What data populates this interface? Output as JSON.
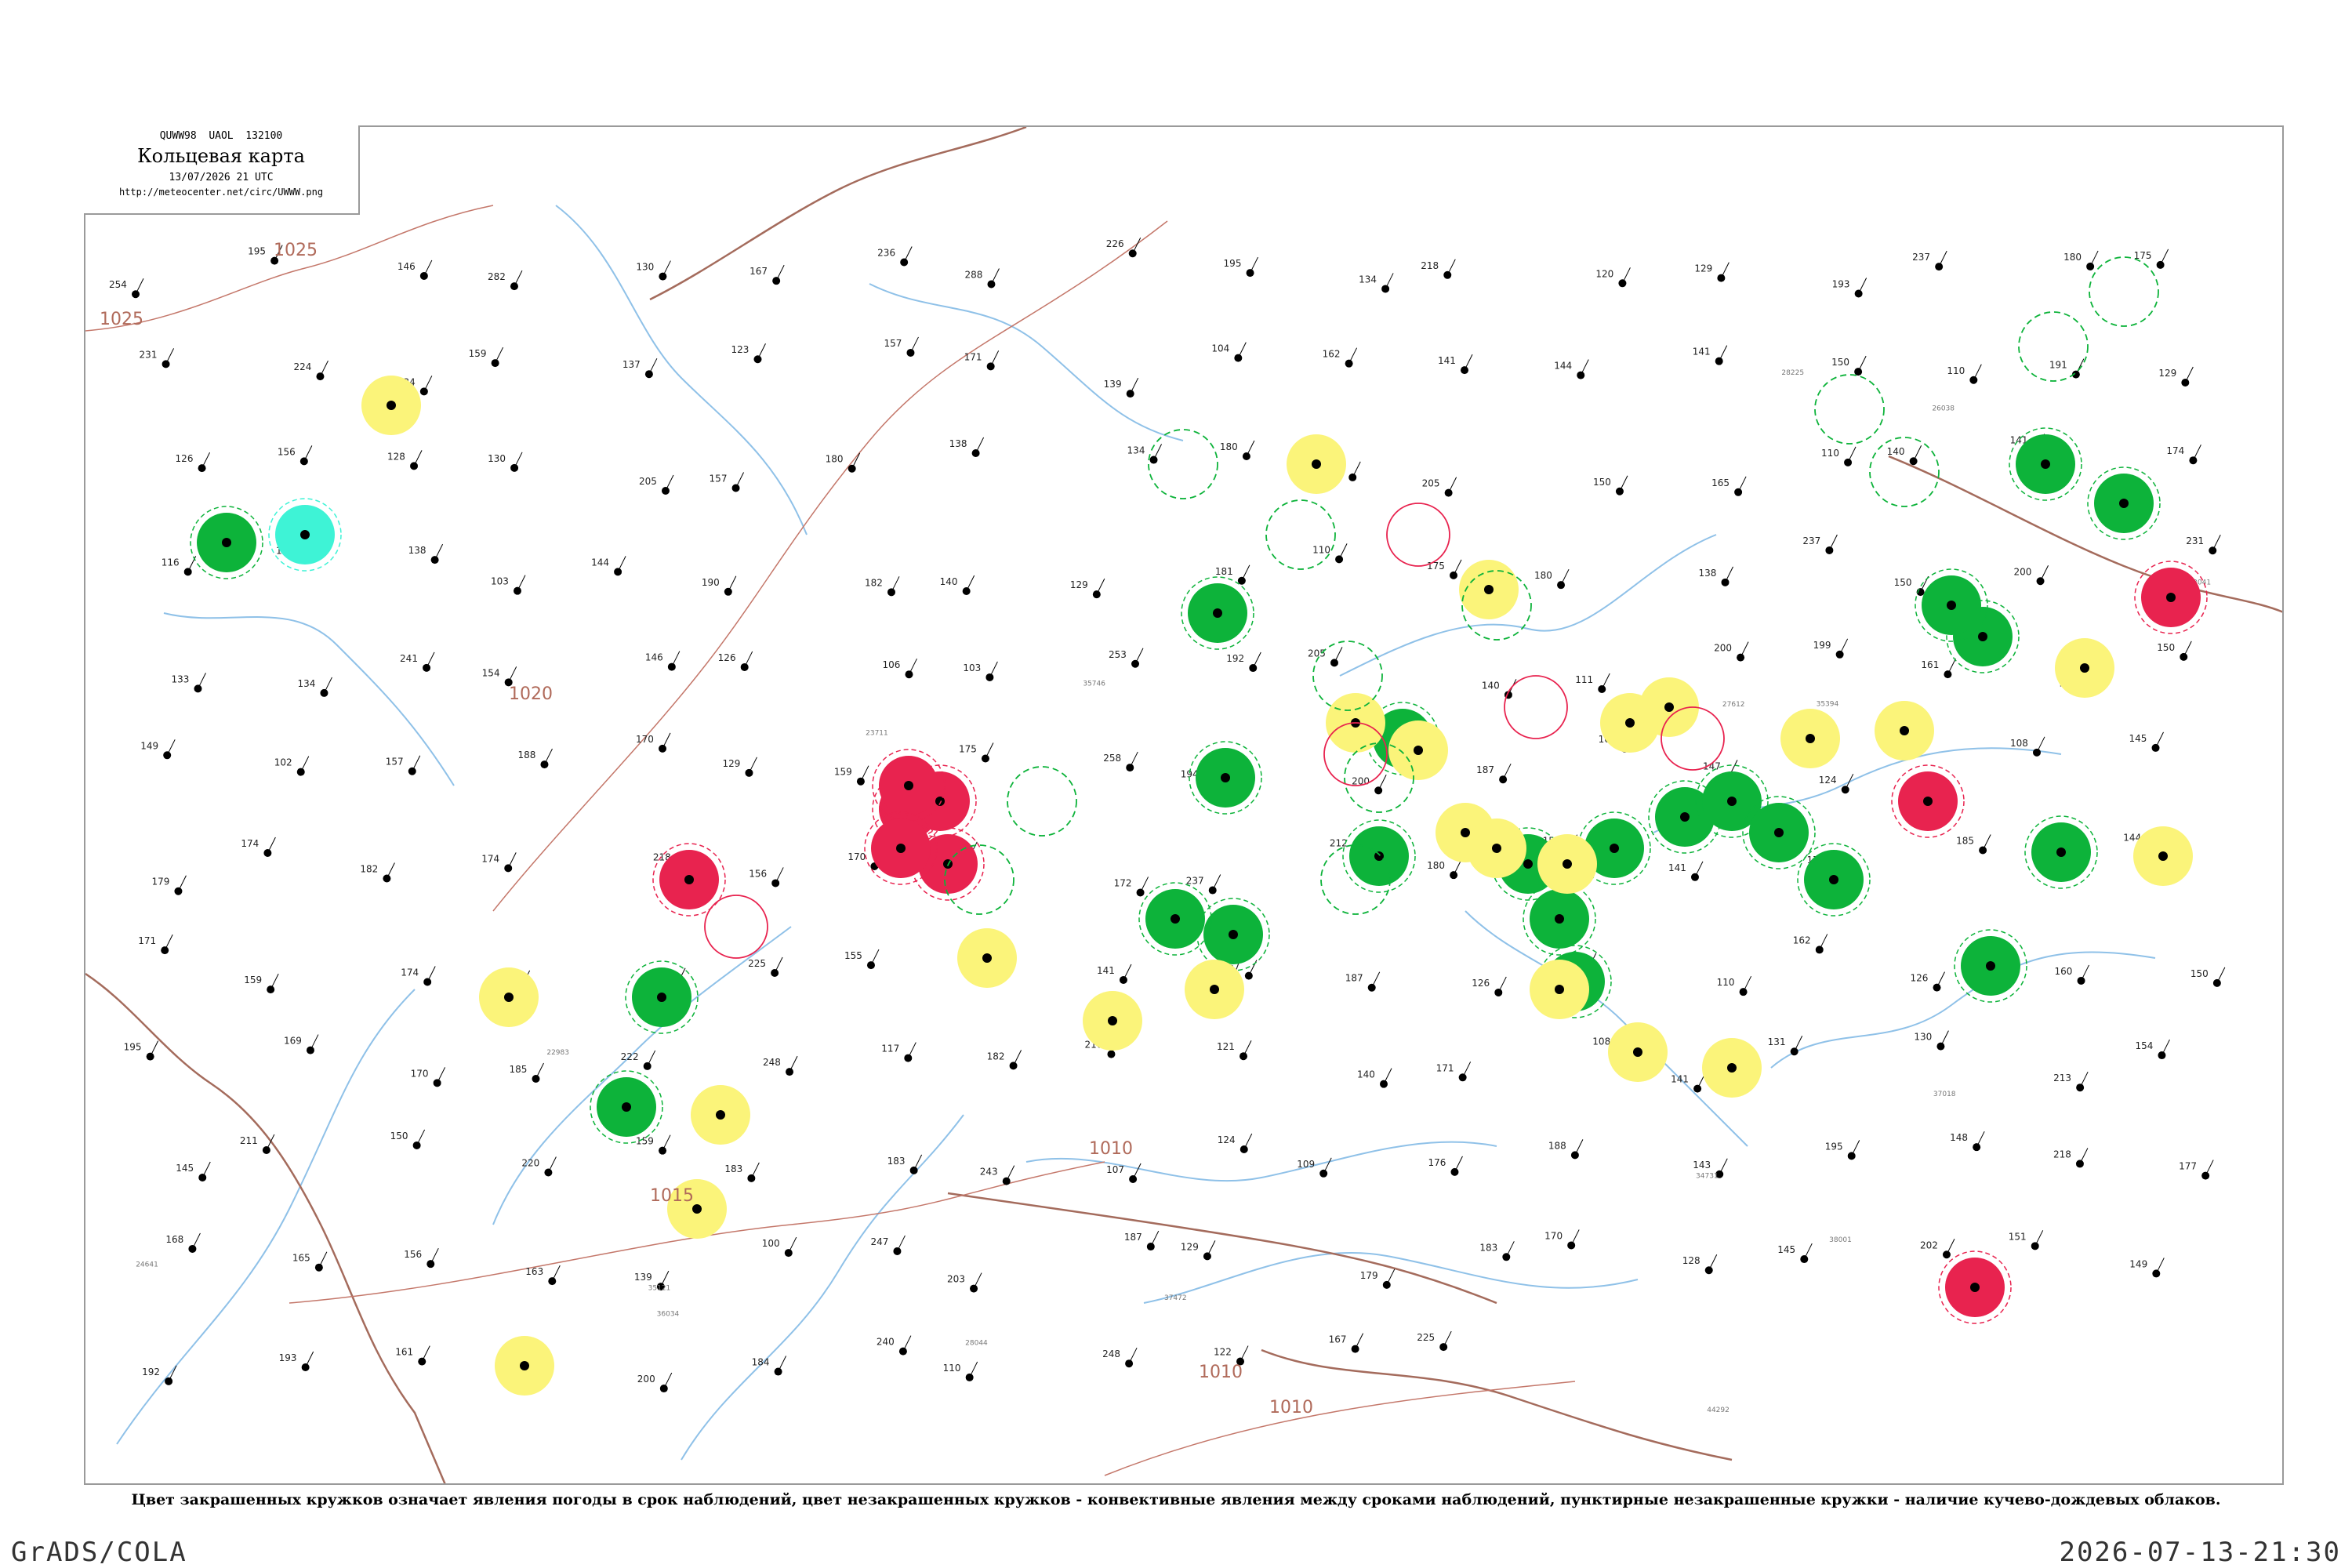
{
  "header": {
    "code_line": "QUWW98  UAOL  132100",
    "title": "Кольцевая карта",
    "date": "13/07/2026 21 UTC",
    "url": "http://meteocenter.net/circ/UWWW.png"
  },
  "caption": "Цвет закрашенных кружков означает явления погоды в срок наблюдений, цвет незакрашенных кружков - конвективные явления между сроками наблюдений, пунктирные незакрашенные кружки - наличие кучево-дождевых облаков.",
  "footer": {
    "left": "GrADS/COLA",
    "right": "2026-07-13-21:30"
  },
  "colors": {
    "green": "#0db33a",
    "red": "#e8234f",
    "yellow": "#fbf47a",
    "cyan": "#3ef3d6",
    "river": "#8fc1e8",
    "border": "#a46b5c",
    "isobar": "#c4776a"
  },
  "isobar_labels": [
    "1025",
    "1025",
    "1020",
    "1015",
    "1010",
    "1010",
    "1010"
  ],
  "observation_labels": [
    "254",
    "195",
    "146",
    "282",
    "130",
    "167",
    "236",
    "288",
    "226",
    "195",
    "134",
    "218",
    "120",
    "129",
    "193",
    "237",
    "180",
    "175",
    "231",
    "224",
    "234",
    "159",
    "137",
    "123",
    "157",
    "171",
    "139",
    "104",
    "162",
    "141",
    "144",
    "141",
    "150",
    "110",
    "191",
    "129",
    "126",
    "156",
    "128",
    "130",
    "205",
    "157",
    "180",
    "138",
    "134",
    "180",
    "160",
    "205",
    "150",
    "165",
    "110",
    "140",
    "141",
    "174",
    "116",
    "160",
    "138",
    "103",
    "144",
    "190",
    "182",
    "140",
    "129",
    "181",
    "110",
    "175",
    "180",
    "138",
    "237",
    "150",
    "200",
    "231",
    "133",
    "134",
    "241",
    "154",
    "146",
    "126",
    "106",
    "103",
    "253",
    "192",
    "205",
    "140",
    "111",
    "200",
    "199",
    "161",
    "135",
    "150",
    "149",
    "102",
    "157",
    "188",
    "170",
    "129",
    "159",
    "175",
    "258",
    "194",
    "200",
    "187",
    "167",
    "147",
    "124",
    "130",
    "108",
    "145",
    "179",
    "174",
    "182",
    "174",
    "218",
    "156",
    "170",
    "211",
    "172",
    "237",
    "212",
    "180",
    "151",
    "141",
    "179",
    "185",
    "178",
    "144",
    "171",
    "159",
    "174",
    "173",
    "166",
    "225",
    "155",
    "135",
    "141",
    "157",
    "187",
    "126",
    "210",
    "110",
    "162",
    "126",
    "160",
    "150",
    "195",
    "169",
    "170",
    "185",
    "222",
    "248",
    "117",
    "182",
    "216",
    "121",
    "140",
    "171",
    "108",
    "141",
    "131",
    "130",
    "213",
    "154",
    "145",
    "211",
    "150",
    "220",
    "159",
    "183",
    "183",
    "243",
    "107",
    "124",
    "109",
    "176",
    "188",
    "143",
    "195",
    "148",
    "218",
    "177",
    "168",
    "165",
    "156",
    "163",
    "139",
    "100",
    "247",
    "203",
    "187",
    "129",
    "179",
    "183",
    "170",
    "128",
    "145",
    "202",
    "151",
    "149",
    "192",
    "193",
    "161",
    "138",
    "200",
    "184",
    "240",
    "110",
    "248",
    "122",
    "167",
    "225"
  ],
  "station_ids": [
    "23711",
    "22983",
    "23804",
    "24641",
    "26038",
    "27612",
    "28044",
    "28225",
    "33041",
    "34172",
    "34300",
    "34731",
    "35121",
    "35394",
    "35746",
    "36034",
    "37018",
    "37472",
    "38001",
    "44292"
  ],
  "station_circles": [
    {
      "kind": "green"
    },
    {
      "kind": "green"
    },
    {
      "kind": "green"
    },
    {
      "kind": "green"
    },
    {
      "kind": "green"
    },
    {
      "kind": "green"
    },
    {
      "kind": "green"
    },
    {
      "kind": "green"
    },
    {
      "kind": "green"
    },
    {
      "kind": "green"
    },
    {
      "kind": "green"
    },
    {
      "kind": "green"
    },
    {
      "kind": "green"
    },
    {
      "kind": "green"
    },
    {
      "kind": "green"
    },
    {
      "kind": "green"
    },
    {
      "kind": "green"
    },
    {
      "kind": "green"
    },
    {
      "kind": "green"
    },
    {
      "kind": "green"
    },
    {
      "kind": "green"
    },
    {
      "kind": "green"
    },
    {
      "kind": "green"
    },
    {
      "kind": "red"
    },
    {
      "kind": "red"
    },
    {
      "kind": "red"
    },
    {
      "kind": "red"
    },
    {
      "kind": "red"
    },
    {
      "kind": "red"
    },
    {
      "kind": "red"
    },
    {
      "kind": "red"
    },
    {
      "kind": "red"
    },
    {
      "kind": "yellow"
    },
    {
      "kind": "yellow"
    },
    {
      "kind": "yellow"
    },
    {
      "kind": "yellow"
    },
    {
      "kind": "yellow"
    },
    {
      "kind": "yellow"
    },
    {
      "kind": "yellow"
    },
    {
      "kind": "yellow"
    },
    {
      "kind": "yellow"
    },
    {
      "kind": "yellow"
    },
    {
      "kind": "yellow"
    },
    {
      "kind": "yellow"
    },
    {
      "kind": "yellow"
    },
    {
      "kind": "yellow"
    },
    {
      "kind": "yellow"
    },
    {
      "kind": "yellow"
    },
    {
      "kind": "yellow"
    },
    {
      "kind": "yellow"
    },
    {
      "kind": "yellow"
    },
    {
      "kind": "yellow"
    },
    {
      "kind": "yellow"
    },
    {
      "kind": "yellow"
    },
    {
      "kind": "yellow"
    },
    {
      "kind": "yellow"
    },
    {
      "kind": "cyan"
    },
    {
      "kind": "green-dashed"
    },
    {
      "kind": "green-dashed"
    },
    {
      "kind": "green-dashed"
    },
    {
      "kind": "green-dashed"
    },
    {
      "kind": "green-dashed"
    },
    {
      "kind": "green-dashed"
    },
    {
      "kind": "green-dashed"
    },
    {
      "kind": "green-dashed"
    },
    {
      "kind": "green-dashed"
    },
    {
      "kind": "green-dashed"
    },
    {
      "kind": "green-dashed"
    },
    {
      "kind": "green-dashed"
    },
    {
      "kind": "red-dashed"
    },
    {
      "kind": "red-dashed"
    },
    {
      "kind": "red-dashed"
    },
    {
      "kind": "red-dashed"
    },
    {
      "kind": "red-dashed"
    }
  ]
}
